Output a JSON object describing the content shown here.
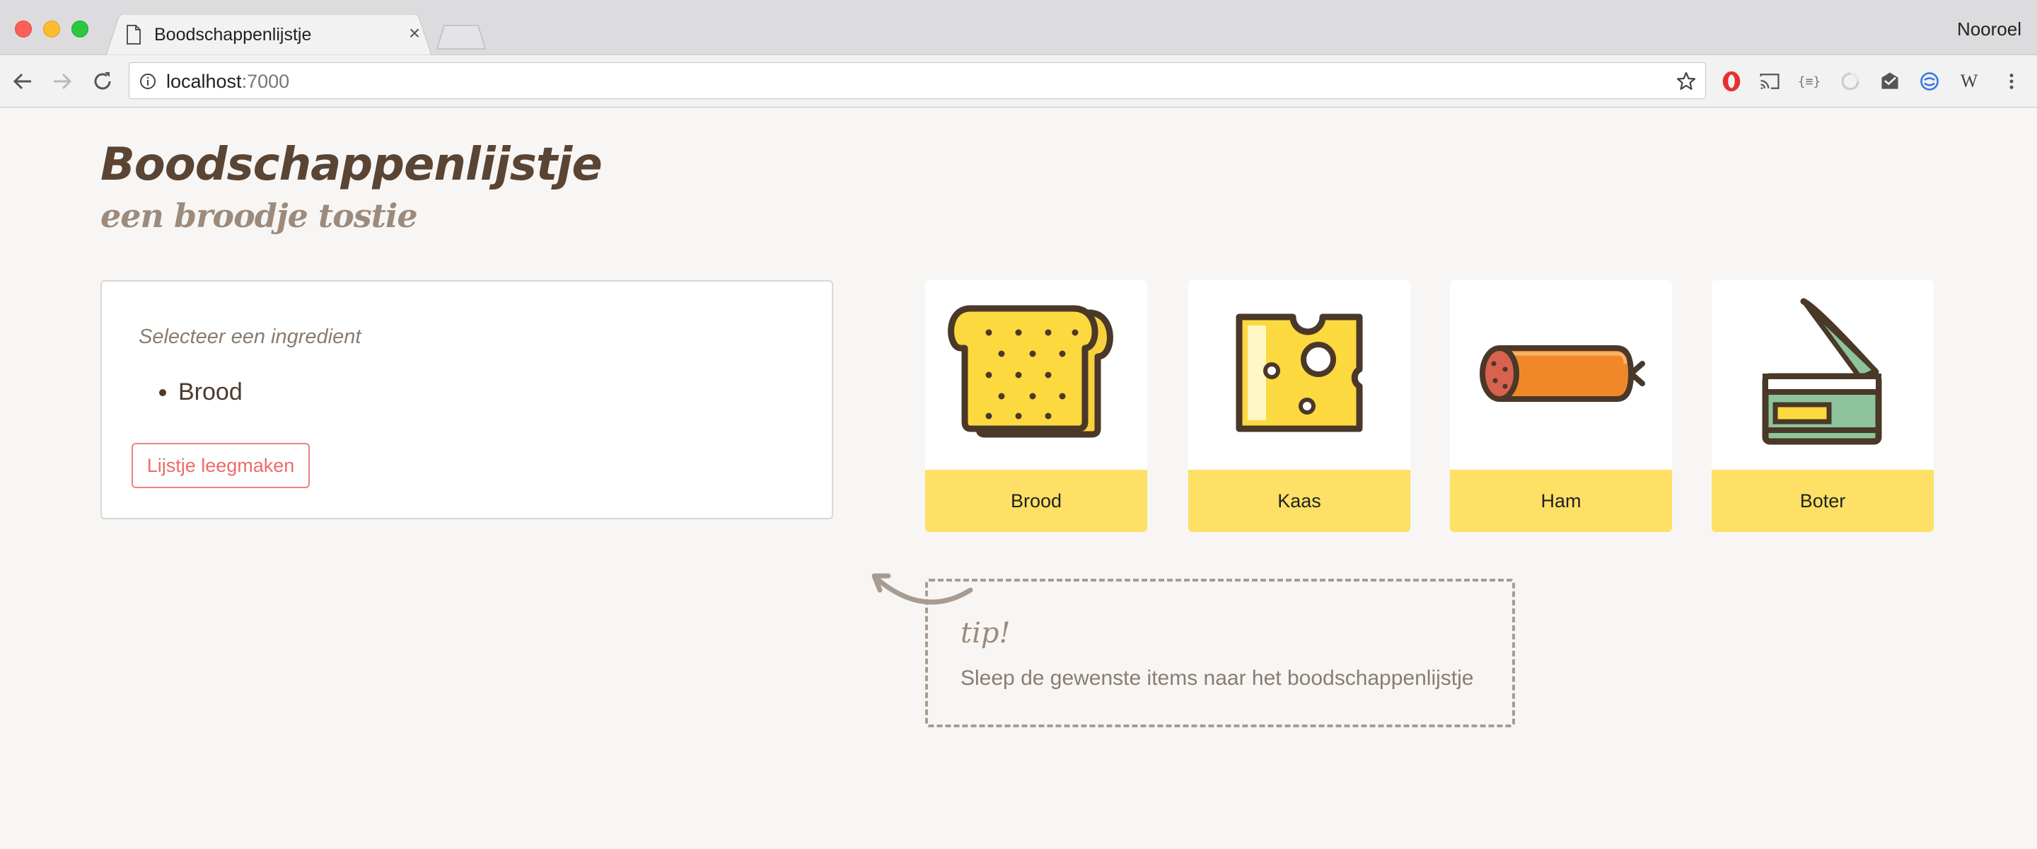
{
  "browser": {
    "tab_title": "Boodschappenlijstje",
    "profile_name": "Nooroel",
    "url_host": "localhost",
    "url_port": ":7000",
    "extensions": [
      "opera-icon",
      "cast-icon",
      "json-viewer-icon",
      "pocket-icon",
      "inbox-icon",
      "sync-icon",
      "wikipedia-icon"
    ]
  },
  "page": {
    "title": "Boodschappenlijstje",
    "subtitle": "een broodje tostie"
  },
  "shopping_list": {
    "hint": "Selecteer een ingredient",
    "items": [
      "Brood"
    ],
    "clear_button": "Lijstje leegmaken"
  },
  "ingredients": [
    {
      "label": "Brood",
      "icon": "bread-icon"
    },
    {
      "label": "Kaas",
      "icon": "cheese-icon"
    },
    {
      "label": "Ham",
      "icon": "sausage-icon"
    },
    {
      "label": "Boter",
      "icon": "butter-tin-icon"
    }
  ],
  "tip": {
    "title": "tip!",
    "text": "Sleep de gewenste items naar het boodschappenlijstje"
  },
  "colors": {
    "title": "#5a4434",
    "accent_yellow": "#fde065",
    "button_red": "#ee6a6a",
    "background": "#f7f6f4"
  }
}
